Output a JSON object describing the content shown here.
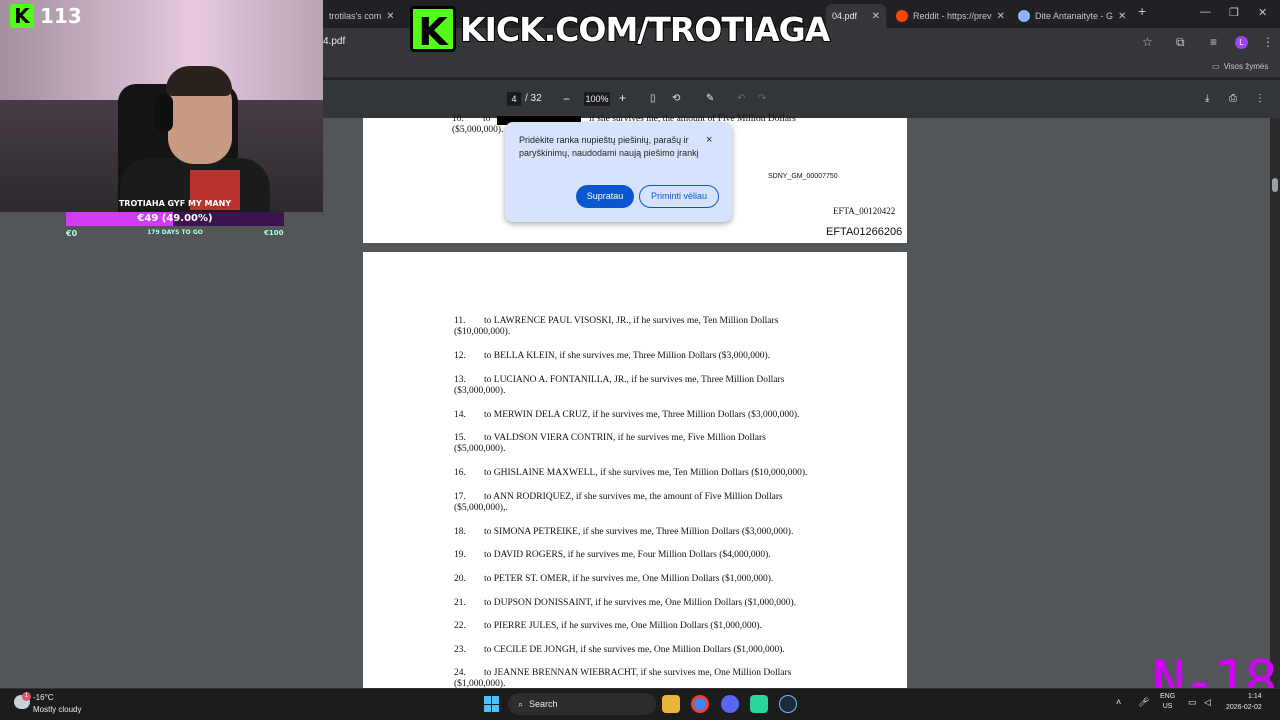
{
  "browser": {
    "tabs": [
      {
        "title": "trotilas's com",
        "favicon_color": "#8ab4f8"
      },
      {
        "title": "04.pdf",
        "favicon_color": "#ea4335"
      },
      {
        "title": "Reddit - https://prev",
        "favicon_color": "#ff4500"
      },
      {
        "title": "Dite Antanaityte - G",
        "favicon_color": "#8ab4f8"
      }
    ],
    "new_tab": "+",
    "url_fragment": "4.pdf",
    "bookmarks_label": "Visos žymės",
    "profile_initial": "L"
  },
  "pdf_toolbar": {
    "current_page": "4",
    "total_pages": "/ 32",
    "zoom": "100%",
    "zoom_out": "−",
    "zoom_in": "+"
  },
  "page3": {
    "item10_num": "10.",
    "item10_to": "to",
    "item10_rest": "if she survives me, the amount of Five Million Dollars",
    "item10_amount": "($5,000,000).",
    "bates_sdny": "SDNY_GM_00007750",
    "bates_efta1": "EFTA_00120422",
    "bates_efta2": "EFTA01266206"
  },
  "page4": {
    "items": [
      {
        "num": "11.",
        "text": "to LAWRENCE PAUL VISOSKI, JR., if he survives me, Ten Million Dollars",
        "cont": "($10,000,000)."
      },
      {
        "num": "12.",
        "text": "to BELLA KLEIN, if she survives me, Three Million Dollars  ($3,000,000).",
        "cont": ""
      },
      {
        "num": "13.",
        "text": "to LUCIANO A. FONTANILLA, JR., if he survives me, Three Million Dollars",
        "cont": "($3,000,000)."
      },
      {
        "num": "14.",
        "text": "to MERWIN DELA CRUZ, if he survives me, Three Million Dollars ($3,000,000).",
        "cont": ""
      },
      {
        "num": "15.",
        "text": "to VALDSON VIERA CONTRIN, if he survives me, Five Million Dollars",
        "cont": "($5,000,000)."
      },
      {
        "num": "16.",
        "text": "to GHISLAINE MAXWELL, if she survives me, Ten Million Dollars ($10,000,000).",
        "cont": ""
      },
      {
        "num": "17.",
        "text": "to ANN RODRIQUEZ, if she survives me, the amount of Five Million Dollars",
        "cont": "($5,000,000),."
      },
      {
        "num": "18.",
        "text": "to SIMONA PETREIKE, if she survives me, Three Million Dollars ($3,000,000).",
        "cont": ""
      },
      {
        "num": "19.",
        "text": "to DAVID ROGERS, if he survives me, Four Million Dollars ($4,000,000).",
        "cont": ""
      },
      {
        "num": "20.",
        "text": "to PETER ST. OMER, if he survives me, One Million Dollars ($1,000,000).",
        "cont": ""
      },
      {
        "num": "21.",
        "text": "to DUPSON DONISSAINT, if he survives me, One Million Dollars ($1,000,000).",
        "cont": ""
      },
      {
        "num": "22.",
        "text": "to PIERRE JULES, if he survives me, One Million Dollars ($1,000,000).",
        "cont": ""
      },
      {
        "num": "23.",
        "text": "to CECILE DE JONGH, if she survives me, One Million Dollars ($1,000,000).",
        "cont": ""
      },
      {
        "num": "24.",
        "text": "to JEANNE BRENNAN WIEBRACHT, if she survives me, One Million Dollars",
        "cont": "($1,000,000)."
      }
    ]
  },
  "popup": {
    "message": "Pridėkite ranka nupieštų piešinių, parašų ir paryškinimų, naudodami naują piešimo įrankį",
    "ok_label": "Supratau",
    "later_label": "Priminti vėliau",
    "close": "×"
  },
  "stream": {
    "kick_count": "113",
    "goal_title": "TROTIAHA GYF MY MANY",
    "goal_amount": "€49 (49.00%)",
    "goal_progress": 0.49,
    "goal_min": "€0",
    "goal_days": "179 DAYS TO GO",
    "goal_max": "€100",
    "banner_k": "K",
    "banner_text": "KICK.COM/TROTIAGA",
    "age_rating": "N-18"
  },
  "taskbar": {
    "weather_temp": "-16°C",
    "weather_desc": "Mostly cloudy",
    "search_label": "Search",
    "lang_top": "ENG",
    "lang_bottom": "US",
    "time": "1:14",
    "date": "2026-02-02",
    "notification_badge": "1"
  }
}
